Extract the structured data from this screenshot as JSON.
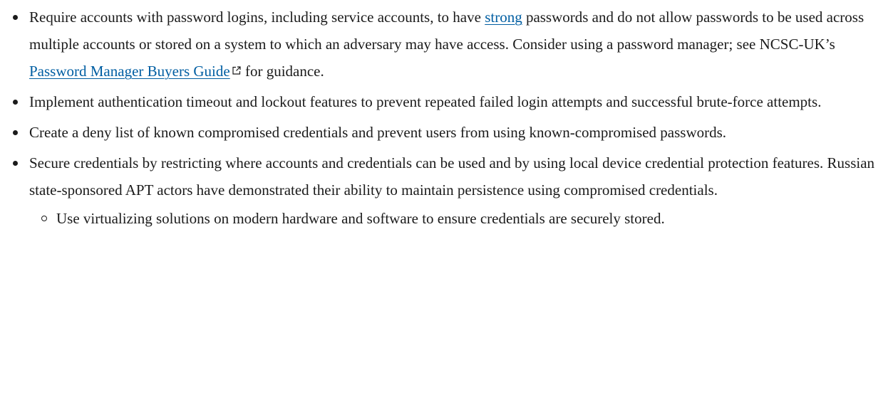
{
  "bullets": [
    {
      "before_link": "Require accounts with password logins, including service accounts, to have ",
      "link_text": "strong",
      "after_link": " passwords and do not allow passwords to be used across multiple accounts or stored on a system to which an adversary may have access. Consider using a password manager; see NCSC-UK’s ",
      "link2_text": "Password Manager Buyers Guide",
      "link2_icon": "external-link-icon",
      "after_link2": " for guidance."
    },
    {
      "text": "Implement authentication timeout and lockout features to prevent repeated failed login attempts and successful brute-force attempts."
    },
    {
      "text": "Create a deny list of known compromised credentials and prevent users from using known-compromised passwords."
    },
    {
      "text": "Secure credentials by restricting where accounts and credentials can be used and by using local device credential protection features. Russian state-sponsored APT actors have demonstrated their ability to maintain persistence using compromised credentials."
    }
  ],
  "sub_bullets": [
    {
      "text": "Use virtualizing solutions on modern hardware and software to ensure credentials are securely stored."
    }
  ],
  "colors": {
    "text": "#1b1b1b",
    "link": "#005ea2"
  }
}
